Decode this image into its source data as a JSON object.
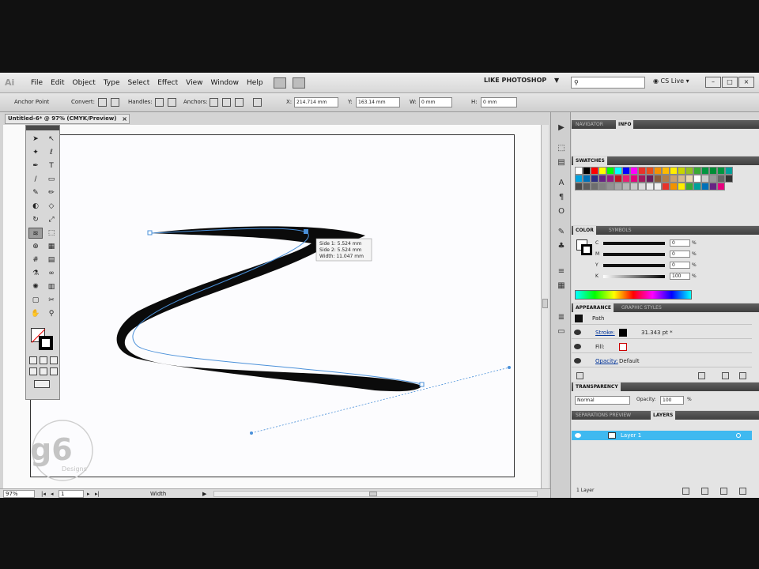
{
  "app": {
    "logo": "Ai",
    "workspace": "LIKE PHOTOSHOP",
    "cs_live": "CS Live",
    "menu": [
      "File",
      "Edit",
      "Object",
      "Type",
      "Select",
      "Effect",
      "View",
      "Window",
      "Help"
    ]
  },
  "controlbar": {
    "anchor_point": "Anchor Point",
    "convert": "Convert:",
    "handles": "Handles:",
    "anchors": "Anchors:",
    "x_label": "X:",
    "x_value": "214.714 mm",
    "y_label": "Y:",
    "y_value": "163.14 mm",
    "w_label": "W:",
    "w_value": "0 mm",
    "h_label": "H:",
    "h_value": "0 mm"
  },
  "document": {
    "tab_title": "Untitled-6* @ 97% (CMYK/Preview)",
    "close": "×",
    "tooltip": {
      "side1": "Side 1: 5.524 mm",
      "side2": "Side 2: 5.524 mm",
      "width": "Width: 11.047 mm"
    },
    "watermark_main": "g6",
    "watermark_sub": "Designs"
  },
  "statusbar": {
    "zoom": "97%",
    "page": "1",
    "tool": "Width"
  },
  "panels": {
    "navigator_tab": "NAVIGATOR",
    "info_tab": "INFO",
    "swatches_tab": "SWATCHES",
    "color_tab": "COLOR",
    "symbols_tab": "SYMBOLS",
    "color_c": "C",
    "color_m": "M",
    "color_y": "Y",
    "color_k": "K",
    "value_c": "0",
    "value_m": "0",
    "value_y": "0",
    "value_k": "100",
    "pct": "%",
    "appearance_tab": "APPEARANCE",
    "graphic_styles_tab": "GRAPHIC STYLES",
    "ap_path": "Path",
    "ap_stroke": "Stroke:",
    "ap_stroke_value": "31.343 pt *",
    "ap_fill": "Fill:",
    "ap_opacity": "Opacity:",
    "ap_opacity_value": "Default",
    "transparency_tab": "TRANSPARENCY",
    "blend_mode": "Normal",
    "opacity_label": "Opacity:",
    "opacity_value": "100",
    "separations_tab": "SEPARATIONS PREVIEW",
    "layers_tab": "LAYERS",
    "layer_name": "Layer 1",
    "layer_count": "1 Layer"
  },
  "colors": {
    "swatches": [
      "#ffffff",
      "#000000",
      "#ff0000",
      "#ffff00",
      "#00ff00",
      "#00ffff",
      "#0000ff",
      "#ff00ff",
      "#e8332a",
      "#e94e1b",
      "#f39200",
      "#fbba00",
      "#ffed00",
      "#c8d400",
      "#95c11f",
      "#3aaa35",
      "#009640",
      "#008d36",
      "#00963f",
      "#00a19a",
      "#00a3e0",
      "#0071b8",
      "#2d2e83",
      "#662483",
      "#951b81",
      "#be1622",
      "#e71d73",
      "#e6007e",
      "#a3195b",
      "#6b1d5c",
      "#8a5d3b",
      "#b17f4a",
      "#c8a070",
      "#d6b98c",
      "#e9d5b1",
      "#ffffff",
      "#cccccc",
      "#999999",
      "#666666",
      "#333333",
      "#4a4a4a",
      "#5c5c5c",
      "#6e6e6e",
      "#808080",
      "#929292",
      "#a4a4a4",
      "#b6b6b6",
      "#c8c8c8",
      "#dadada",
      "#ececec",
      "#f0f0f0",
      "#e8332a",
      "#f39200",
      "#ffed00",
      "#3aaa35",
      "#00a19a",
      "#0071b8",
      "#662483",
      "#e6007e"
    ]
  }
}
